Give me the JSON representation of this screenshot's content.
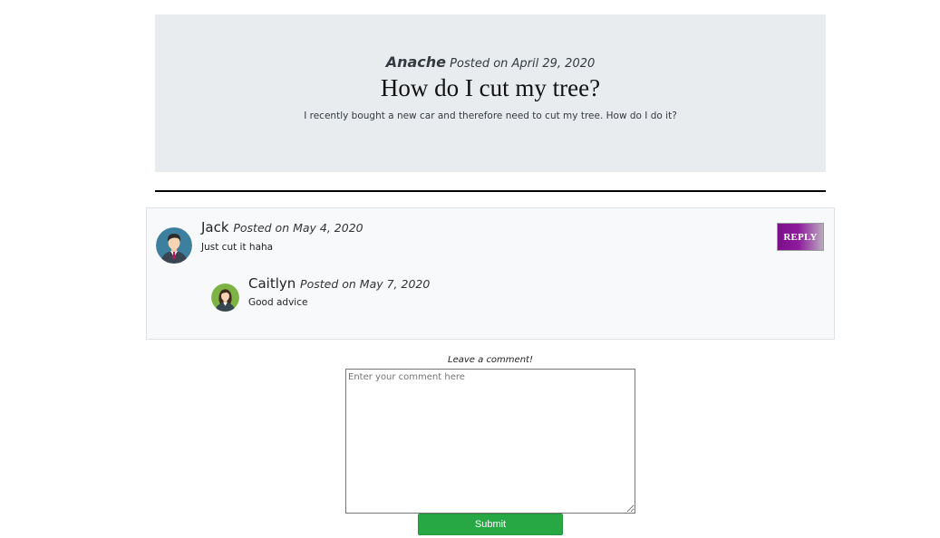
{
  "post": {
    "author": "Anache",
    "posted_on": "Posted on April 29, 2020",
    "title": "How do I cut my tree?",
    "body": "I recently bought a new car and therefore need to cut my tree. How do I do it?"
  },
  "comments": [
    {
      "name": "Jack",
      "posted_on": "Posted on May 4, 2020",
      "text": "Just cut it haha",
      "avatar_icon": "male-avatar-icon",
      "reply_label": "REPLY",
      "replies": [
        {
          "name": "Caitlyn",
          "posted_on": "Posted on May 7, 2020",
          "text": "Good advice",
          "avatar_icon": "female-avatar-icon"
        }
      ]
    }
  ],
  "comment_form": {
    "label": "Leave a comment!",
    "placeholder": "Enter your comment here",
    "submit_label": "Submit"
  },
  "colors": {
    "header_bg": "#e9ecef",
    "reply_accent": "#7b0f8a",
    "submit_bg": "#28a745"
  }
}
